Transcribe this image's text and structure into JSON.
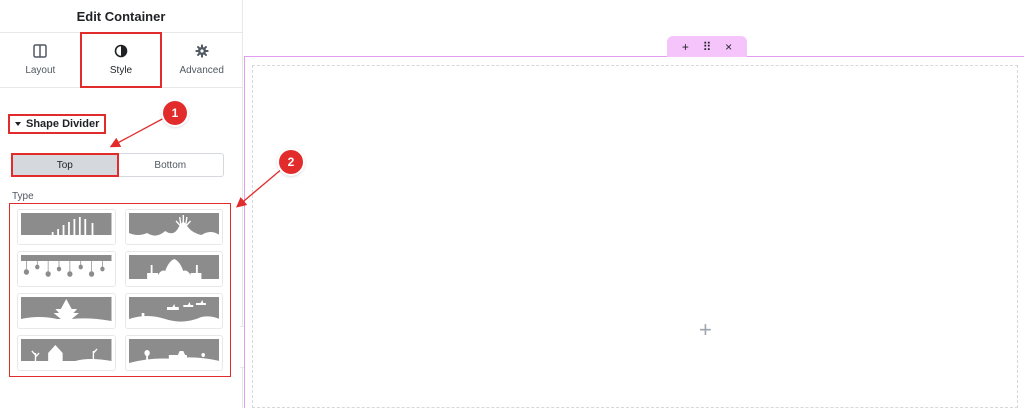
{
  "panel": {
    "title": "Edit Container",
    "tabs": [
      {
        "label": "Layout",
        "icon": "layout-icon"
      },
      {
        "label": "Style",
        "icon": "contrast-icon"
      },
      {
        "label": "Advanced",
        "icon": "gear-icon"
      }
    ],
    "active_tab": "Style",
    "section_title": "Shape Divider",
    "position_toggle": {
      "options": [
        "Top",
        "Bottom"
      ],
      "selected": "Top"
    },
    "type_label": "Type",
    "shape_types": [
      "bars-shape",
      "fountain-shape",
      "lanterns-shape",
      "mosque-shape",
      "christmas-tree-shape",
      "reindeer-sleigh-shape",
      "haunted-house-shape",
      "landscape-shape"
    ]
  },
  "canvas": {
    "handle_icons": [
      "+",
      "⠿",
      "×"
    ],
    "add_icon": "+"
  },
  "annotations": [
    {
      "label": "1"
    },
    {
      "label": "2"
    }
  ],
  "colors": {
    "highlight": "#e22b2b",
    "container_outline": "#e29cf0",
    "handle_bg": "#f4c4fa",
    "shape_fill": "#8c8c8c"
  }
}
